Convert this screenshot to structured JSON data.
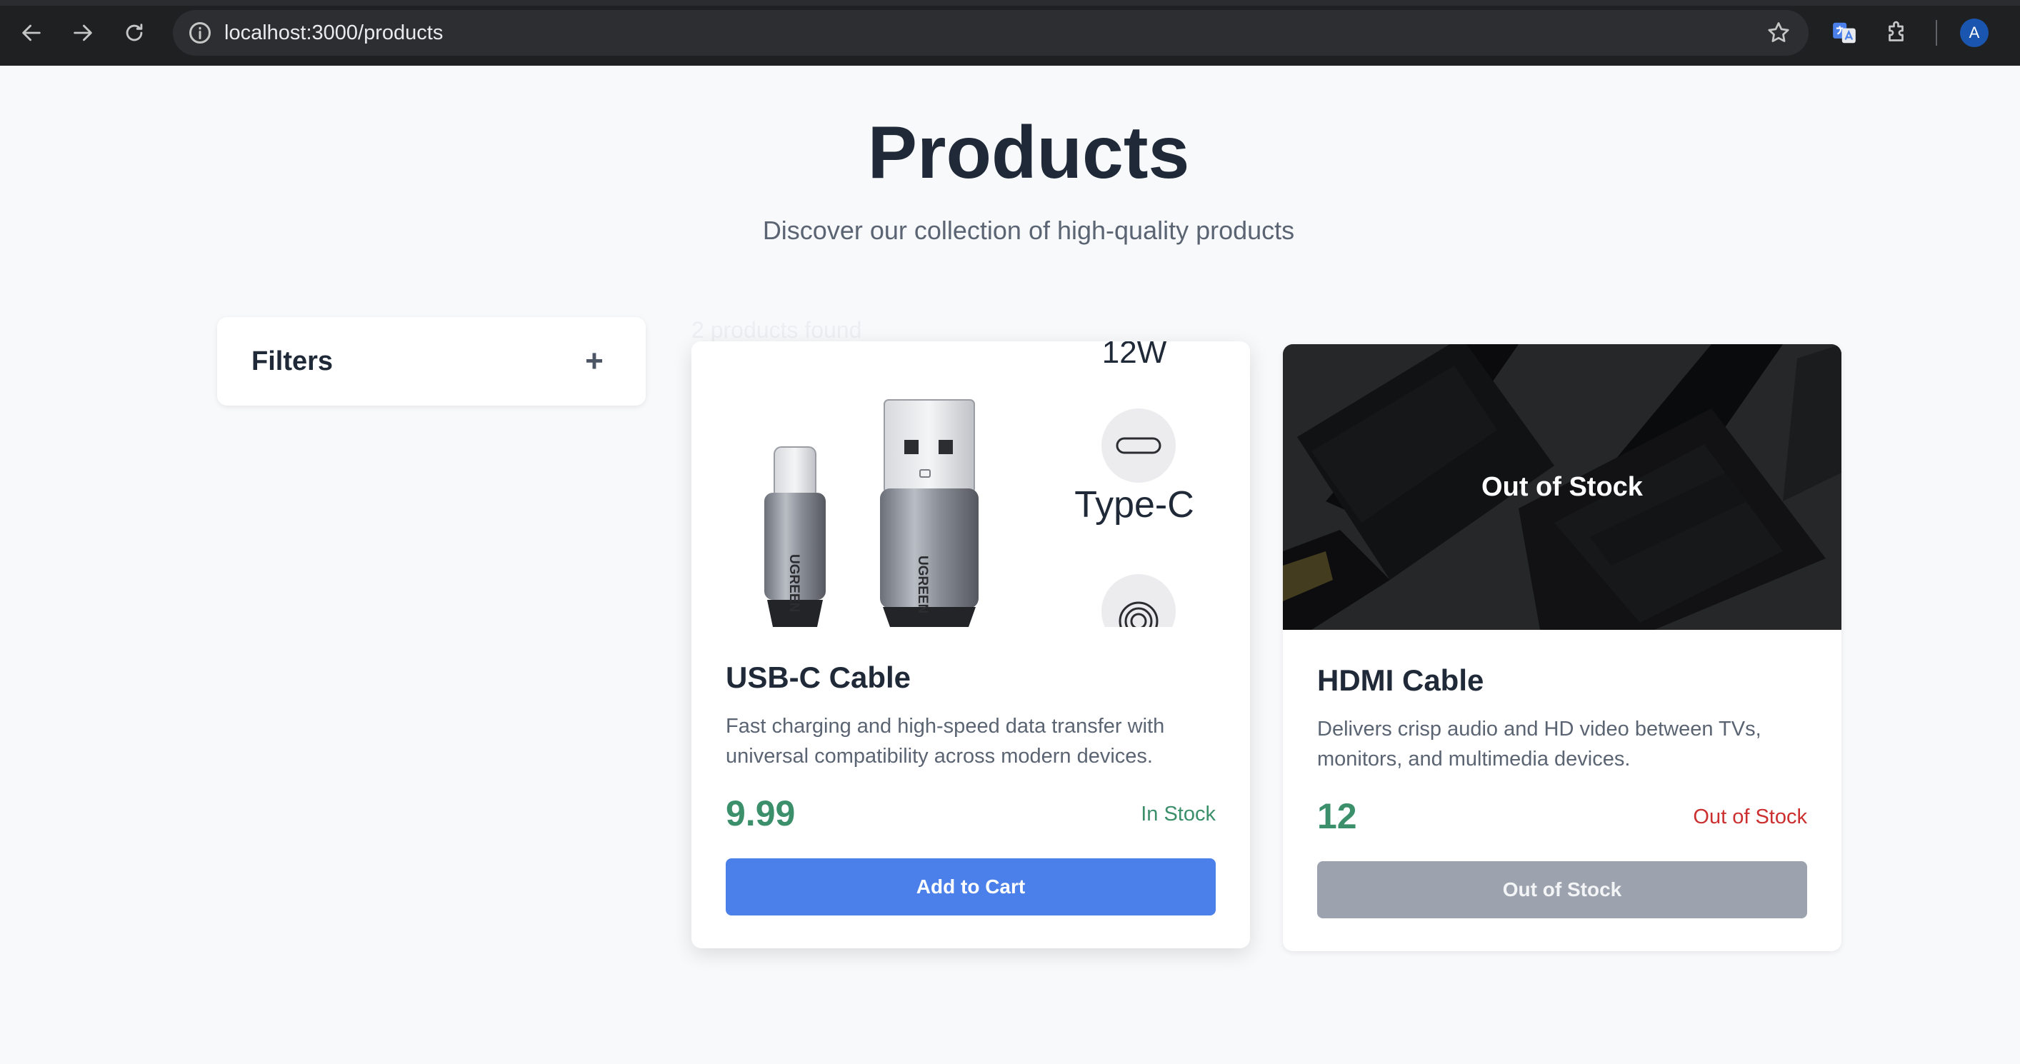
{
  "browser": {
    "url": "localhost:3000/products",
    "profile_initial": "A"
  },
  "header": {
    "title": "Products",
    "subtitle": "Discover our collection of high-quality products"
  },
  "filters": {
    "label": "Filters",
    "toggle": "+"
  },
  "results": {
    "count_text": "2 products found"
  },
  "products": [
    {
      "name": "USB-C Cable",
      "description": "Fast charging and high-speed data transfer with universal compatibility across modern devices.",
      "price": "9.99",
      "stock_status": "In Stock",
      "button_label": "Add to Cart",
      "image_labels": {
        "power": "12W",
        "connector": "Type-C",
        "brand": "UGREEN"
      }
    },
    {
      "name": "HDMI Cable",
      "description": "Delivers crisp audio and HD video between TVs, monitors, and multimedia devices.",
      "price": "12",
      "stock_status": "Out of Stock",
      "button_label": "Out of Stock",
      "overlay_label": "Out of Stock"
    }
  ],
  "colors": {
    "accent": "#4b80ea",
    "price_green": "#3b8f6b",
    "out_of_stock_red": "#cc2f2f",
    "disabled_gray": "#9ca3ae"
  },
  "icons": {
    "back": "arrow-left-icon",
    "forward": "arrow-right-icon",
    "reload": "reload-icon",
    "info": "info-icon",
    "bookmark": "star-icon",
    "translate": "translate-icon",
    "extensions": "puzzle-icon"
  }
}
